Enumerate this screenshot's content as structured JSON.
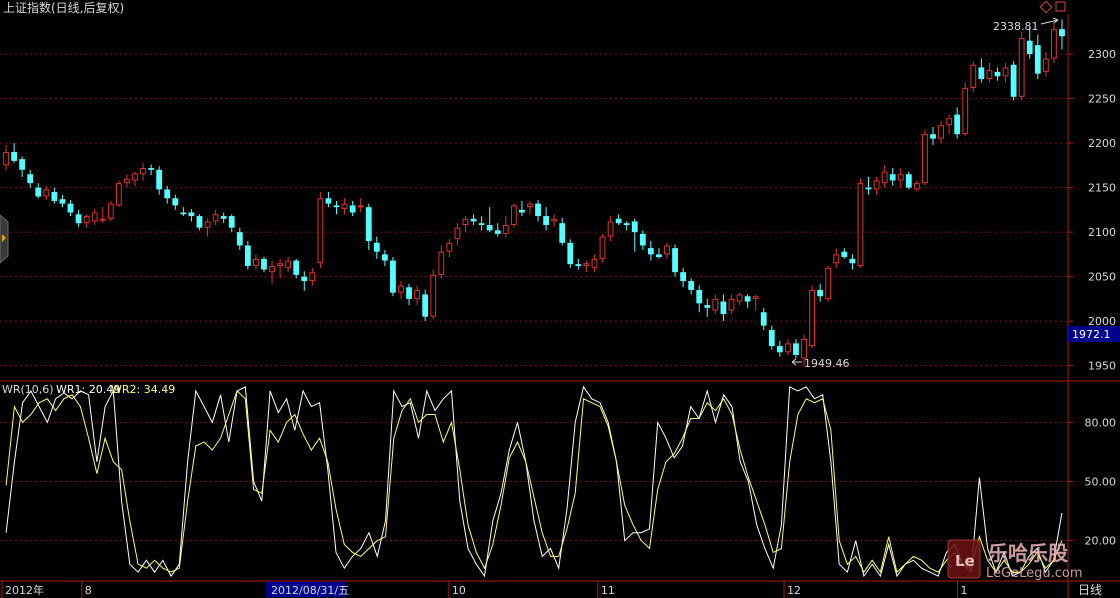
{
  "header": {
    "title": "上证指数(日线,后复权)",
    "indicator": "WR(10,6)",
    "wr1_label": "WR1: 20.49",
    "wr2_label": "WR2: 34.49",
    "period": "日线",
    "current_price": "1972.1",
    "high_label": "2338.81",
    "low_label": "1949.46"
  },
  "watermark": {
    "text": "乐哈乐股",
    "url": "LeGeLegu.com"
  },
  "colors": {
    "up": "#e0312e",
    "down": "#54ffff",
    "grid": "#7a1010",
    "axis": "#b01818",
    "wr1": "#ffffff",
    "wr2": "#ffff66",
    "price_box": "#00008c"
  },
  "chart_data": [
    {
      "type": "candlestick",
      "title": "上证指数(日线,后复权)",
      "y_ticks": [
        "2300",
        "2250",
        "2200",
        "2150",
        "2100",
        "2050",
        "2000",
        "1950"
      ],
      "ylim": [
        1935,
        2345
      ],
      "x_ticks": [
        "2012年",
        "8",
        "2012/08/31/五",
        "10",
        "11",
        "12",
        "1"
      ],
      "annotations": [
        {
          "text": "2338.81",
          "kind": "high"
        },
        {
          "text": "1949.46",
          "kind": "low"
        }
      ],
      "ohlc": [
        [
          2175,
          2198,
          2170,
          2190
        ],
        [
          2190,
          2200,
          2178,
          2180
        ],
        [
          2182,
          2185,
          2162,
          2170
        ],
        [
          2165,
          2170,
          2150,
          2155
        ],
        [
          2150,
          2155,
          2138,
          2140
        ],
        [
          2140,
          2152,
          2136,
          2148
        ],
        [
          2145,
          2150,
          2132,
          2135
        ],
        [
          2137,
          2142,
          2128,
          2132
        ],
        [
          2132,
          2136,
          2118,
          2122
        ],
        [
          2120,
          2125,
          2106,
          2110
        ],
        [
          2110,
          2120,
          2105,
          2118
        ],
        [
          2112,
          2126,
          2108,
          2122
        ],
        [
          2114,
          2128,
          2110,
          2115
        ],
        [
          2115,
          2135,
          2112,
          2132
        ],
        [
          2130,
          2158,
          2128,
          2155
        ],
        [
          2155,
          2165,
          2150,
          2160
        ],
        [
          2158,
          2168,
          2152,
          2166
        ],
        [
          2165,
          2178,
          2158,
          2172
        ],
        [
          2172,
          2176,
          2164,
          2170
        ],
        [
          2170,
          2174,
          2142,
          2148
        ],
        [
          2148,
          2152,
          2132,
          2138
        ],
        [
          2138,
          2142,
          2125,
          2130
        ],
        [
          2122,
          2128,
          2118,
          2120
        ],
        [
          2122,
          2126,
          2112,
          2118
        ],
        [
          2118,
          2120,
          2102,
          2105
        ],
        [
          2105,
          2115,
          2095,
          2112
        ],
        [
          2112,
          2125,
          2108,
          2120
        ],
        [
          2118,
          2122,
          2110,
          2115
        ],
        [
          2118,
          2120,
          2100,
          2105
        ],
        [
          2100,
          2105,
          2080,
          2085
        ],
        [
          2085,
          2090,
          2058,
          2062
        ],
        [
          2062,
          2075,
          2058,
          2070
        ],
        [
          2070,
          2072,
          2055,
          2058
        ],
        [
          2055,
          2068,
          2042,
          2062
        ],
        [
          2062,
          2070,
          2048,
          2065
        ],
        [
          2060,
          2072,
          2055,
          2068
        ],
        [
          2068,
          2070,
          2048,
          2052
        ],
        [
          2050,
          2056,
          2034,
          2045
        ],
        [
          2045,
          2060,
          2040,
          2055
        ],
        [
          2065,
          2145,
          2060,
          2138
        ],
        [
          2138,
          2145,
          2128,
          2132
        ],
        [
          2130,
          2135,
          2120,
          2128
        ],
        [
          2126,
          2138,
          2120,
          2132
        ],
        [
          2130,
          2135,
          2118,
          2122
        ],
        [
          2128,
          2138,
          2122,
          2130
        ],
        [
          2128,
          2132,
          2080,
          2090
        ],
        [
          2088,
          2095,
          2070,
          2078
        ],
        [
          2075,
          2080,
          2062,
          2068
        ],
        [
          2068,
          2072,
          2028,
          2032
        ],
        [
          2032,
          2045,
          2025,
          2040
        ],
        [
          2038,
          2042,
          2018,
          2025
        ],
        [
          2025,
          2040,
          2018,
          2035
        ],
        [
          2030,
          2035,
          2000,
          2005
        ],
        [
          2005,
          2058,
          2002,
          2052
        ],
        [
          2052,
          2085,
          2048,
          2078
        ],
        [
          2078,
          2092,
          2072,
          2088
        ],
        [
          2092,
          2110,
          2085,
          2105
        ],
        [
          2108,
          2118,
          2100,
          2115
        ],
        [
          2115,
          2120,
          2108,
          2112
        ],
        [
          2110,
          2118,
          2102,
          2108
        ],
        [
          2108,
          2128,
          2100,
          2102
        ],
        [
          2102,
          2110,
          2095,
          2098
        ],
        [
          2098,
          2118,
          2094,
          2108
        ],
        [
          2108,
          2132,
          2105,
          2130
        ],
        [
          2125,
          2135,
          2118,
          2122
        ],
        [
          2128,
          2135,
          2120,
          2132
        ],
        [
          2132,
          2136,
          2112,
          2118
        ],
        [
          2118,
          2128,
          2102,
          2108
        ],
        [
          2112,
          2120,
          2106,
          2115
        ],
        [
          2110,
          2116,
          2085,
          2088
        ],
        [
          2088,
          2092,
          2060,
          2064
        ],
        [
          2064,
          2070,
          2058,
          2062
        ],
        [
          2062,
          2068,
          2055,
          2065
        ],
        [
          2060,
          2075,
          2055,
          2070
        ],
        [
          2070,
          2098,
          2066,
          2095
        ],
        [
          2095,
          2118,
          2090,
          2112
        ],
        [
          2115,
          2120,
          2108,
          2110
        ],
        [
          2110,
          2112,
          2102,
          2108
        ],
        [
          2112,
          2115,
          2078,
          2100
        ],
        [
          2098,
          2102,
          2080,
          2085
        ],
        [
          2082,
          2090,
          2068,
          2075
        ],
        [
          2075,
          2082,
          2070,
          2072
        ],
        [
          2075,
          2088,
          2070,
          2085
        ],
        [
          2082,
          2086,
          2050,
          2055
        ],
        [
          2055,
          2060,
          2038,
          2045
        ],
        [
          2045,
          2048,
          2030,
          2035
        ],
        [
          2035,
          2040,
          2010,
          2020
        ],
        [
          2018,
          2025,
          2005,
          2015
        ],
        [
          2012,
          2030,
          2008,
          2025
        ],
        [
          2022,
          2030,
          2000,
          2008
        ],
        [
          2012,
          2030,
          2008,
          2025
        ],
        [
          2022,
          2032,
          2018,
          2030
        ],
        [
          2028,
          2030,
          2015,
          2022
        ],
        [
          2025,
          2030,
          2012,
          2028
        ],
        [
          2010,
          2015,
          1990,
          1995
        ],
        [
          1990,
          1995,
          1968,
          1972
        ],
        [
          1972,
          1978,
          1960,
          1965
        ],
        [
          1965,
          1980,
          1962,
          1975
        ],
        [
          1975,
          1980,
          1958,
          1962
        ],
        [
          1958,
          1985,
          1950,
          1980
        ],
        [
          1972,
          2040,
          1970,
          2035
        ],
        [
          2035,
          2042,
          2022,
          2028
        ],
        [
          2025,
          2062,
          2022,
          2060
        ],
        [
          2065,
          2082,
          2060,
          2075
        ],
        [
          2078,
          2082,
          2070,
          2072
        ],
        [
          2070,
          2075,
          2058,
          2065
        ],
        [
          2062,
          2160,
          2060,
          2155
        ],
        [
          2150,
          2162,
          2142,
          2148
        ],
        [
          2148,
          2162,
          2142,
          2158
        ],
        [
          2155,
          2175,
          2150,
          2168
        ],
        [
          2165,
          2172,
          2152,
          2158
        ],
        [
          2158,
          2172,
          2150,
          2165
        ],
        [
          2165,
          2168,
          2148,
          2150
        ],
        [
          2148,
          2158,
          2145,
          2155
        ],
        [
          2155,
          2215,
          2152,
          2210
        ],
        [
          2210,
          2218,
          2198,
          2205
        ],
        [
          2205,
          2225,
          2200,
          2220
        ],
        [
          2220,
          2232,
          2210,
          2228
        ],
        [
          2232,
          2240,
          2205,
          2210
        ],
        [
          2210,
          2268,
          2208,
          2262
        ],
        [
          2262,
          2292,
          2258,
          2288
        ],
        [
          2285,
          2295,
          2268,
          2272
        ],
        [
          2272,
          2290,
          2268,
          2282
        ],
        [
          2280,
          2285,
          2270,
          2275
        ],
        [
          2275,
          2290,
          2268,
          2285
        ],
        [
          2288,
          2292,
          2248,
          2252
        ],
        [
          2252,
          2325,
          2248,
          2318
        ],
        [
          2315,
          2330,
          2295,
          2300
        ],
        [
          2310,
          2322,
          2272,
          2278
        ],
        [
          2280,
          2302,
          2275,
          2295
        ],
        [
          2295,
          2335,
          2290,
          2328
        ],
        [
          2328,
          2339,
          2305,
          2320
        ]
      ]
    },
    {
      "type": "line",
      "title": "WR(10,6)",
      "y_ticks": [
        "80.00",
        "50.00",
        "20.00"
      ],
      "ylim": [
        0,
        100
      ],
      "series": [
        {
          "name": "WR1",
          "values": [
            24,
            60,
            90,
            96,
            88,
            80,
            92,
            95,
            92,
            96,
            94,
            60,
            88,
            96,
            40,
            8,
            4,
            10,
            4,
            10,
            2,
            8,
            60,
            96,
            88,
            80,
            94,
            70,
            96,
            98,
            50,
            40,
            96,
            85,
            92,
            76,
            96,
            88,
            90,
            56,
            14,
            6,
            12,
            16,
            24,
            12,
            30,
            96,
            88,
            90,
            72,
            96,
            86,
            92,
            96,
            40,
            16,
            8,
            2,
            30,
            44,
            66,
            80,
            60,
            30,
            12,
            16,
            6,
            36,
            80,
            98,
            92,
            90,
            80,
            60,
            20,
            24,
            24,
            26,
            80,
            72,
            62,
            68,
            88,
            82,
            96,
            80,
            94,
            88,
            60,
            50,
            28,
            16,
            6,
            28,
            98,
            96,
            98,
            92,
            94,
            60,
            8,
            4,
            20,
            2,
            8,
            2,
            18,
            2,
            8,
            10,
            6,
            4,
            2,
            14,
            18,
            8,
            4,
            52,
            16,
            4,
            14,
            2,
            4,
            12,
            16,
            4,
            10,
            34
          ]
        },
        {
          "name": "WR2",
          "values": [
            48,
            88,
            80,
            84,
            90,
            92,
            86,
            92,
            94,
            88,
            72,
            54,
            72,
            60,
            56,
            30,
            8,
            6,
            10,
            6,
            4,
            6,
            40,
            68,
            70,
            66,
            72,
            84,
            96,
            92,
            46,
            44,
            76,
            70,
            80,
            84,
            74,
            66,
            72,
            60,
            36,
            18,
            14,
            12,
            16,
            20,
            22,
            72,
            86,
            92,
            80,
            84,
            84,
            70,
            80,
            56,
            28,
            14,
            6,
            18,
            38,
            62,
            70,
            60,
            42,
            24,
            12,
            12,
            26,
            44,
            92,
            90,
            88,
            78,
            60,
            38,
            28,
            20,
            16,
            46,
            60,
            64,
            72,
            82,
            82,
            90,
            86,
            92,
            84,
            66,
            52,
            40,
            28,
            14,
            16,
            60,
            84,
            92,
            90,
            92,
            76,
            20,
            8,
            12,
            4,
            10,
            4,
            22,
            4,
            8,
            12,
            10,
            6,
            4,
            10,
            14,
            8,
            6,
            22,
            10,
            4,
            10,
            4,
            4,
            8,
            14,
            6,
            10,
            20
          ]
        }
      ]
    }
  ]
}
